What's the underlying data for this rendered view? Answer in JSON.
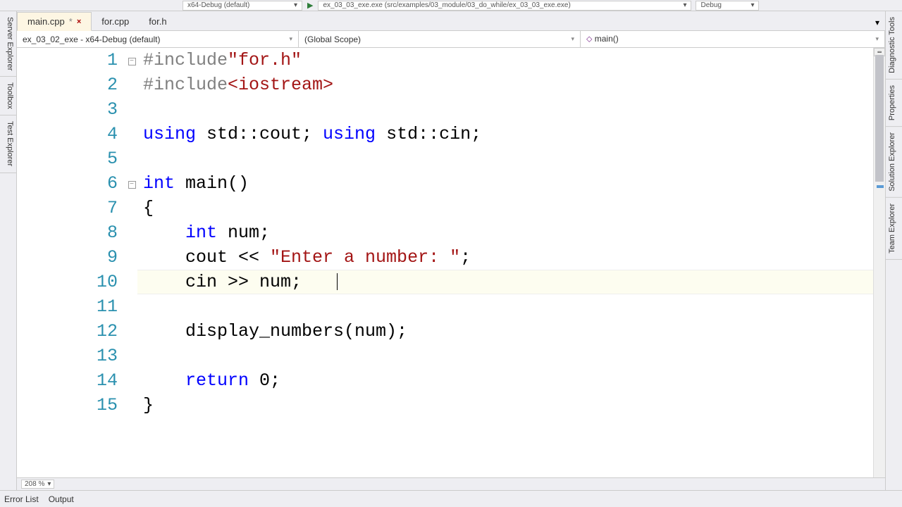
{
  "toolbar": {
    "config": "x64-Debug (default)",
    "launch": "ex_03_03_exe.exe (src/examples/03_module/03_do_while/ex_03_03_exe.exe)",
    "mode": "Debug"
  },
  "sidebar_left": {
    "items": [
      "Server Explorer",
      "Toolbox",
      "Test Explorer"
    ]
  },
  "sidebar_right": {
    "items": [
      "Diagnostic Tools",
      "Properties",
      "Solution Explorer",
      "Team Explorer"
    ]
  },
  "file_tabs": {
    "items": [
      {
        "name": "main.cpp",
        "active": true,
        "modified": true
      },
      {
        "name": "for.cpp",
        "active": false,
        "modified": false
      },
      {
        "name": "for.h",
        "active": false,
        "modified": false
      }
    ]
  },
  "scope": {
    "project": "ex_03_02_exe - x64-Debug (default)",
    "namespace": "(Global Scope)",
    "function": "main()"
  },
  "code": {
    "lines": [
      {
        "n": 1,
        "fold": true,
        "tokens": [
          {
            "c": "k-prep",
            "t": "#include"
          },
          {
            "c": "k-inc",
            "t": "\"for.h\""
          }
        ]
      },
      {
        "n": 2,
        "tokens": [
          {
            "c": "k-prep",
            "t": "#include"
          },
          {
            "c": "k-inc",
            "t": "<iostream>"
          }
        ]
      },
      {
        "n": 3,
        "tokens": []
      },
      {
        "n": 4,
        "tokens": [
          {
            "c": "k-kw",
            "t": "using"
          },
          {
            "c": "k-txt",
            "t": " std::cout; "
          },
          {
            "c": "k-kw",
            "t": "using"
          },
          {
            "c": "k-txt",
            "t": " std::cin;"
          }
        ]
      },
      {
        "n": 5,
        "tokens": []
      },
      {
        "n": 6,
        "fold": true,
        "tokens": [
          {
            "c": "k-kw",
            "t": "int"
          },
          {
            "c": "k-txt",
            "t": " main()"
          }
        ]
      },
      {
        "n": 7,
        "tokens": [
          {
            "c": "k-txt",
            "t": "{"
          }
        ]
      },
      {
        "n": 8,
        "tokens": [
          {
            "c": "k-txt",
            "t": "    "
          },
          {
            "c": "k-kw",
            "t": "int"
          },
          {
            "c": "k-txt",
            "t": " num;"
          }
        ]
      },
      {
        "n": 9,
        "tokens": [
          {
            "c": "k-txt",
            "t": "    cout << "
          },
          {
            "c": "k-str",
            "t": "\"Enter a number: \""
          },
          {
            "c": "k-txt",
            "t": ";"
          }
        ]
      },
      {
        "n": 10,
        "highlight": true,
        "cursor": true,
        "tokens": [
          {
            "c": "k-txt",
            "t": "    cin >> num;"
          }
        ]
      },
      {
        "n": 11,
        "tokens": []
      },
      {
        "n": 12,
        "tokens": [
          {
            "c": "k-txt",
            "t": "    display_numbers(num);"
          }
        ]
      },
      {
        "n": 13,
        "tokens": []
      },
      {
        "n": 14,
        "tokens": [
          {
            "c": "k-txt",
            "t": "    "
          },
          {
            "c": "k-kw",
            "t": "return"
          },
          {
            "c": "k-txt",
            "t": " 0;"
          }
        ]
      },
      {
        "n": 15,
        "tokens": [
          {
            "c": "k-txt",
            "t": "}"
          }
        ]
      }
    ]
  },
  "zoom": "208 %",
  "bottom": {
    "items": [
      "Error List",
      "Output"
    ]
  },
  "func_icon": "⬦"
}
